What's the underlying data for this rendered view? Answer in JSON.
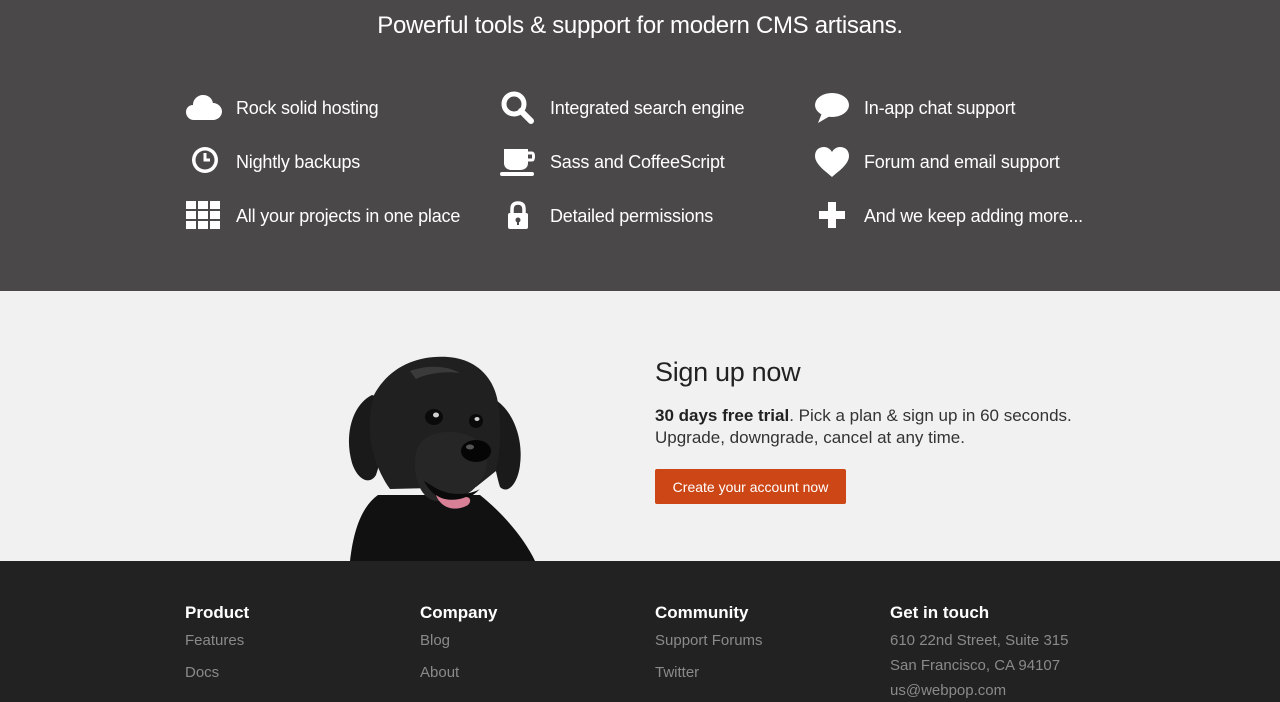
{
  "features": {
    "tagline": "Powerful tools & support for modern CMS artisans.",
    "items": [
      {
        "label": "Rock solid hosting",
        "icon": "cloud-icon"
      },
      {
        "label": "Integrated search engine",
        "icon": "search-icon"
      },
      {
        "label": "In-app chat support",
        "icon": "chat-bubble-icon"
      },
      {
        "label": "Nightly backups",
        "icon": "clock-icon"
      },
      {
        "label": "Sass and CoffeeScript",
        "icon": "coffee-cup-icon"
      },
      {
        "label": "Forum and email support",
        "icon": "heart-icon"
      },
      {
        "label": "All your projects in one place",
        "icon": "grid-icon"
      },
      {
        "label": "Detailed permissions",
        "icon": "lock-icon"
      },
      {
        "label": "And we keep adding more...",
        "icon": "plus-icon"
      }
    ]
  },
  "signup": {
    "title": "Sign up now",
    "trial_bold": "30 days free trial",
    "trial_rest": ". Pick a plan & sign up in 60 seconds.",
    "line2": "Upgrade, downgrade, cancel at any time.",
    "cta": "Create your account now"
  },
  "footer": {
    "product": {
      "heading": "Product",
      "links": [
        "Features",
        "Docs"
      ]
    },
    "company": {
      "heading": "Company",
      "links": [
        "Blog",
        "About"
      ]
    },
    "community": {
      "heading": "Community",
      "links": [
        "Support Forums",
        "Twitter"
      ]
    },
    "contact": {
      "heading": "Get in touch",
      "address1": "610 22nd Street, Suite 315",
      "address2": "San Francisco, CA 94107",
      "email": "us@webpop.com"
    }
  },
  "colors": {
    "features_bg": "#4a4849",
    "signup_bg": "#f1f1f1",
    "accent": "#cc4616",
    "footer_bg": "#222222"
  }
}
